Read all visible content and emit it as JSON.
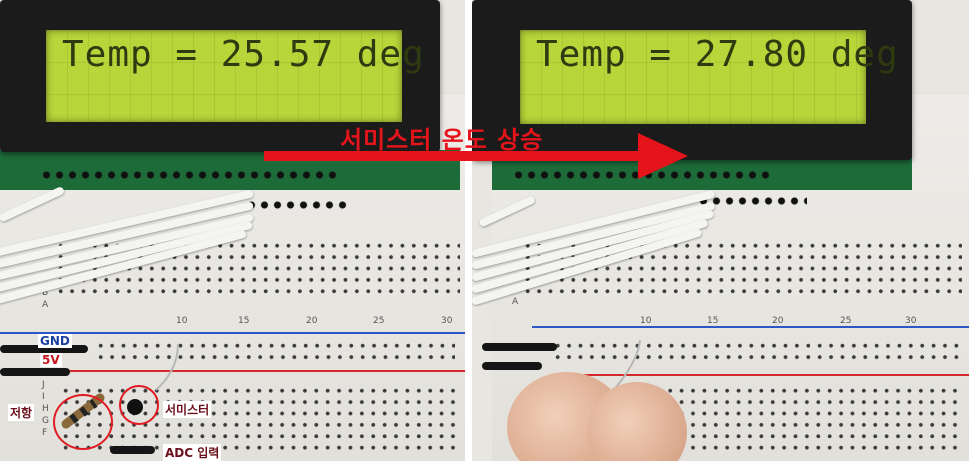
{
  "left_panel": {
    "lcd_text": "Temp = 25.57 deg",
    "labels": {
      "gnd": "GND",
      "v5": "5V",
      "resistor": "저항",
      "thermistor": "서미스터",
      "adc_input": "ADC 입력"
    },
    "breadboard_numbers": [
      "10",
      "15",
      "20",
      "25",
      "30"
    ],
    "row_letters": [
      "B",
      "A",
      "J",
      "I",
      "H",
      "G",
      "F"
    ]
  },
  "right_panel": {
    "lcd_text": "Temp = 27.80 deg",
    "breadboard_numbers": [
      "10",
      "15",
      "20",
      "25",
      "30"
    ],
    "row_letters": [
      "B",
      "A"
    ]
  },
  "arrow": {
    "label": "서미스터 온도 상승",
    "color": "#e5141b"
  },
  "colors": {
    "lcd_background": "#b8d63a",
    "lcd_text": "#2f3a10",
    "gnd_label": "#1b3fa0",
    "v5_label": "#c4161c",
    "annotation_text": "#6b0f1a",
    "circle": "#e01b24",
    "rail_blue": "#2f56c8",
    "rail_red": "#d42a2a"
  }
}
